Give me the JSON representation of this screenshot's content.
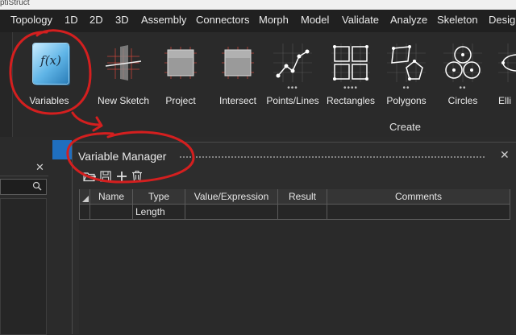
{
  "titlebar": {
    "text": "ptiStruct"
  },
  "menu": [
    "Topology",
    "1D",
    "2D",
    "3D",
    "Assembly",
    "Connectors",
    "Morph",
    "Model",
    "Validate",
    "Analyze",
    "Skeleton",
    "Desig"
  ],
  "ribbon": {
    "variables_label": "Variables",
    "variables_icon_text": "f(x)",
    "tools": [
      {
        "label": "New Sketch",
        "icon": "new-sketch-icon"
      },
      {
        "label": "Project",
        "icon": "project-icon"
      },
      {
        "label": "Intersect",
        "icon": "intersect-icon"
      },
      {
        "label": "Points/Lines",
        "icon": "points-lines-icon"
      },
      {
        "label": "Rectangles",
        "icon": "rectangles-icon"
      },
      {
        "label": "Polygons",
        "icon": "polygons-icon"
      },
      {
        "label": "Circles",
        "icon": "circles-icon"
      },
      {
        "label": "Elli",
        "icon": "ellipse-icon"
      }
    ],
    "group_label": "Create"
  },
  "variable_manager": {
    "title": "Variable Manager",
    "toolbar": [
      "open-icon",
      "save-icon",
      "add-icon",
      "delete-icon"
    ],
    "columns": [
      "Name",
      "Type",
      "Value/Expression",
      "Result",
      "Comments"
    ],
    "rows": [
      {
        "name": "",
        "type": "Length",
        "value": "",
        "result": "",
        "comments": ""
      }
    ]
  },
  "colors": {
    "annotation": "#d41f1f",
    "accent": "#1f6fbf"
  }
}
